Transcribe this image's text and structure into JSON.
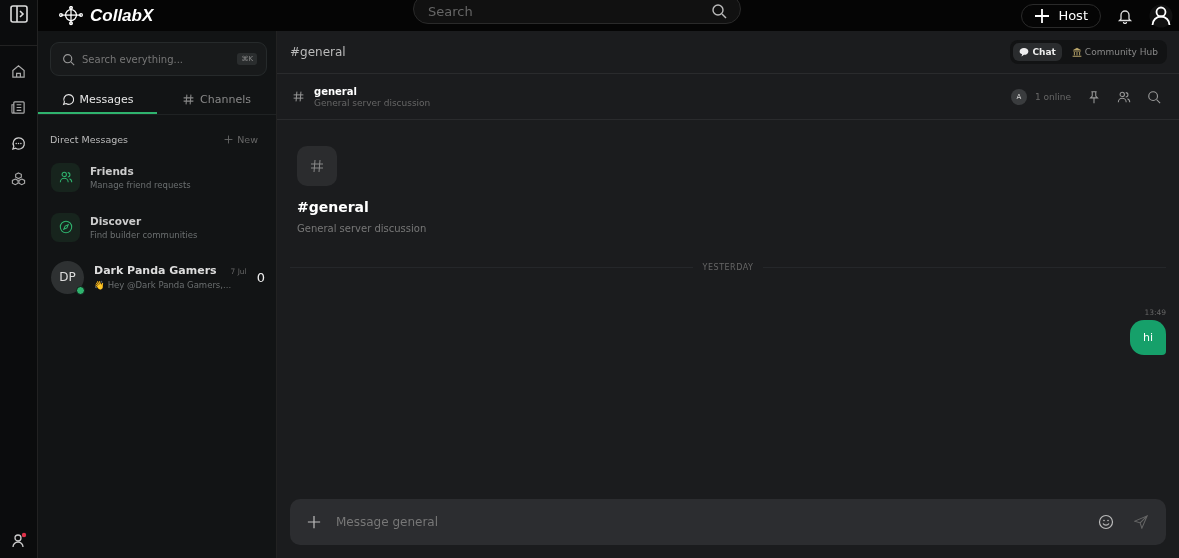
{
  "app": {
    "name": "CollabX"
  },
  "topbar": {
    "search": {
      "placeholder": "Search"
    },
    "host_button": "Host"
  },
  "sidebar": {
    "search": {
      "placeholder": "Search everything...",
      "shortcut": "⌘K"
    },
    "tabs": [
      {
        "label": "Messages",
        "kind": "messages",
        "selected": true
      },
      {
        "label": "Channels",
        "kind": "channels",
        "selected": false
      }
    ],
    "section": {
      "title": "Direct Messages",
      "action": "New"
    },
    "items": [
      {
        "kind": "friends",
        "title": "Friends",
        "subtitle": "Manage friend requests"
      },
      {
        "kind": "discover",
        "title": "Discover",
        "subtitle": "Find builder communities"
      },
      {
        "kind": "dm",
        "initials": "DP",
        "title": "Dark Panda Gamers",
        "date": "7 Jul",
        "subtitle": "👋 Hey @Dark Panda Gamers,...",
        "count": "0",
        "online": true
      }
    ]
  },
  "main": {
    "title": "#general",
    "views": [
      {
        "label": "Chat",
        "kind": "chat",
        "selected": true
      },
      {
        "label": "Community Hub",
        "kind": "hub",
        "selected": false
      }
    ],
    "channel": {
      "name": "general",
      "description": "General server discussion",
      "online_avatar": "A",
      "online": "1 online"
    },
    "intro": {
      "title": "#general",
      "description": "General server discussion"
    },
    "divider": "YESTERDAY",
    "messages": [
      {
        "time": "13:49",
        "text": "hi",
        "own": true
      }
    ],
    "composer": {
      "placeholder": "Message general"
    }
  }
}
